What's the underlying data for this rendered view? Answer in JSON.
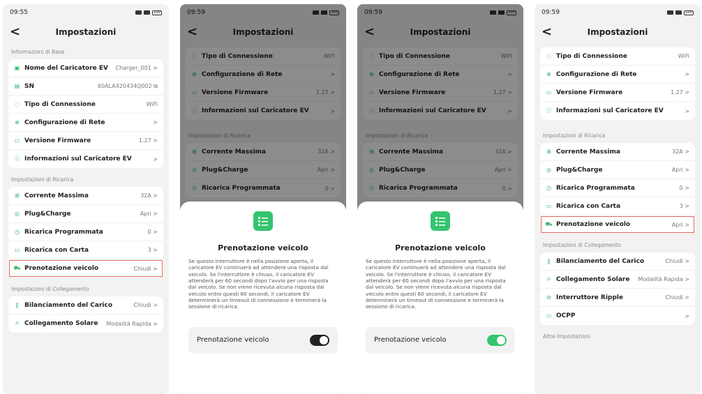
{
  "header": {
    "title": "Impostazioni",
    "back": "<"
  },
  "sections": {
    "base": "Informazioni di Base",
    "charging": "Impostazioni di Ricarica",
    "connection": "Impostazioni di Collegamento",
    "other": "Altre Impostazioni"
  },
  "screens": [
    {
      "time": "09:55",
      "battery": "100",
      "base_items": [
        {
          "label": "Nome del Caricatore EV",
          "value": "Charger_001 >",
          "icon": "charger-icon"
        },
        {
          "label": "SN",
          "value": "60ALA420434Q002",
          "icon": "sn-icon"
        },
        {
          "label": "Tipo di Connessione",
          "value": "WiFi",
          "icon": "wifi-icon"
        },
        {
          "label": "Configurazione di Rete",
          "value": ">",
          "icon": "globe-icon"
        },
        {
          "label": "Versione Firmware",
          "value": "1.27 >",
          "icon": "firmware-icon"
        },
        {
          "label": "Informazioni sul Caricatore EV",
          "value": ">",
          "icon": "info-icon"
        }
      ],
      "charging_items": [
        {
          "label": "Corrente Massima",
          "value": "32A >",
          "icon": "current-icon"
        },
        {
          "label": "Plug&Charge",
          "value": "Apri >",
          "icon": "plug-icon"
        },
        {
          "label": "Ricarica Programmata",
          "value": "0 >",
          "icon": "schedule-icon"
        },
        {
          "label": "Ricarica con Carta",
          "value": "3 >",
          "icon": "card-icon"
        },
        {
          "label": "Prenotazione veicolo",
          "value": "Chiudi >",
          "icon": "car-icon"
        }
      ],
      "connection_items": [
        {
          "label": "Bilanciamento del Carico",
          "value": "Chiudi >",
          "icon": "balance-icon"
        },
        {
          "label": "Collegamento Solare",
          "value": "Modalità Rapida >",
          "icon": "solar-icon"
        }
      ]
    },
    {
      "time": "09:59",
      "battery": "100",
      "top_items": [
        {
          "label": "Tipo di Connessione",
          "value": "WiFi"
        },
        {
          "label": "Configurazione di Rete",
          "value": ">"
        },
        {
          "label": "Versione Firmware",
          "value": "1.27 >"
        },
        {
          "label": "Informazioni sul Caricatore EV",
          "value": ">"
        }
      ],
      "charging_items": [
        {
          "label": "Corrente Massima",
          "value": "32A >"
        },
        {
          "label": "Plug&Charge",
          "value": "Apri >"
        },
        {
          "label": "Ricarica Programmata",
          "value": "0 >"
        }
      ],
      "sheet": {
        "title": "Prenotazione veicolo",
        "text": "Se questo interruttore è nella posizione aperta, il caricatore EV continuerà ad attendere una risposta dal veicolo. Se l'interruttore è chiuso, il caricatore EV attenderà per 60 secondi dopo l'avvio per una risposta dal veicolo. Se non viene ricevuta alcuna risposta dal veicolo entro questi 60 secondi, il caricatore EV determinerà un timeout di connessione e terminerà la sessione di ricarica.",
        "toggle_label": "Prenotazione veicolo",
        "toggle_state": "off"
      }
    },
    {
      "time": "09:59",
      "battery": "100",
      "sheet": {
        "title": "Prenotazione veicolo",
        "toggle_label": "Prenotazione veicolo",
        "toggle_state": "on"
      }
    },
    {
      "time": "09:59",
      "battery": "100",
      "top_items": [
        {
          "label": "Tipo di Connessione",
          "value": "WiFi"
        },
        {
          "label": "Configurazione di Rete",
          "value": ">"
        },
        {
          "label": "Versione Firmware",
          "value": "1.27 >"
        },
        {
          "label": "Informazioni sul Caricatore EV",
          "value": ">"
        }
      ],
      "charging_items": [
        {
          "label": "Corrente Massima",
          "value": "32A >"
        },
        {
          "label": "Plug&Charge",
          "value": "Apri >"
        },
        {
          "label": "Ricarica Programmata",
          "value": "0 >"
        },
        {
          "label": "Ricarica con Carta",
          "value": "3 >"
        },
        {
          "label": "Prenotazione veicolo",
          "value": "Apri >"
        }
      ],
      "connection_items": [
        {
          "label": "Bilanciamento del Carico",
          "value": "Chiudi >"
        },
        {
          "label": "Collegamento Solare",
          "value": "Modalità Rapida >"
        },
        {
          "label": "Interruttore Ripple",
          "value": "Chiudi >"
        },
        {
          "label": "OCPP",
          "value": ">"
        }
      ]
    }
  ],
  "colors": {
    "accent": "#35c46e",
    "highlight": "#e06655"
  }
}
